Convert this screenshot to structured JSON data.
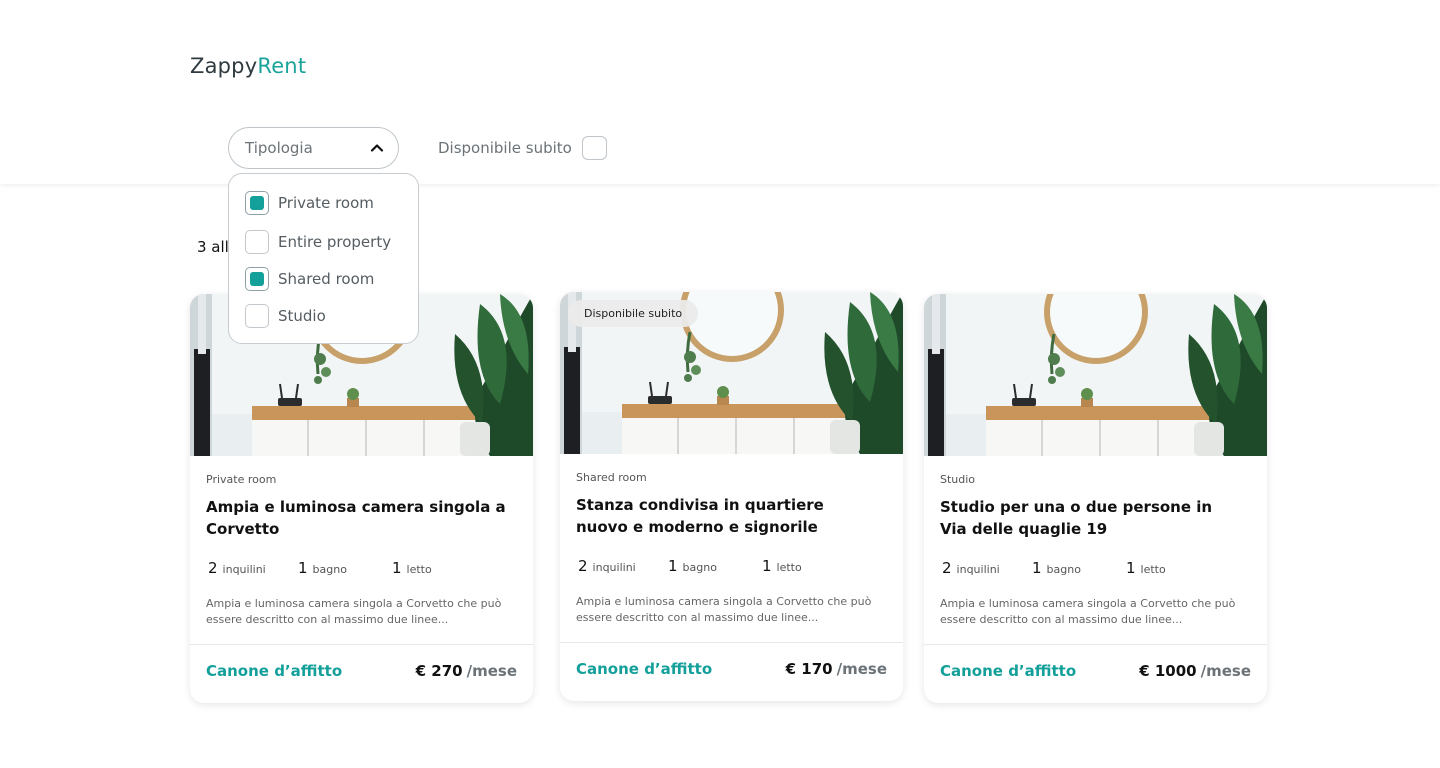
{
  "brand": {
    "name_main": "Zappy",
    "name_accent": "Rent",
    "accent_color": "#1aa39b"
  },
  "filters": {
    "type_select": {
      "placeholder": "Tipologia",
      "expanded": true
    },
    "available_now": {
      "label": "Disponibile subito",
      "checked": false
    },
    "type_options": [
      {
        "label": "Private room",
        "checked": true
      },
      {
        "label": "Entire property",
        "checked": false
      },
      {
        "label": "Shared room",
        "checked": true
      },
      {
        "label": "Studio",
        "checked": false
      }
    ]
  },
  "results": {
    "count_text": "3 all"
  },
  "listings": [
    {
      "badge": "",
      "type": "Private room",
      "title": "Ampia e luminosa camera singola a Corvetto",
      "tenants": "2",
      "tenants_unit": "inquilini",
      "bath": "1",
      "bath_unit": "bagno",
      "bed": "1",
      "bed_unit": "letto",
      "description": "Ampia e luminosa camera singola a Corvetto che può essere descritto con al massimo due linee...",
      "rent_label": "Canone d’affitto",
      "price": "€ 270",
      "per": "/mese"
    },
    {
      "badge": "Disponibile subito",
      "type": "Shared room",
      "title": "Stanza condivisa in quartiere nuovo e moderno e signorile",
      "tenants": "2",
      "tenants_unit": "inquilini",
      "bath": "1",
      "bath_unit": "bagno",
      "bed": "1",
      "bed_unit": "letto",
      "description": "Ampia e luminosa camera singola a Corvetto che può essere descritto con al massimo due linee...",
      "rent_label": "Canone d’affitto",
      "price": "€ 170",
      "per": "/mese"
    },
    {
      "badge": "",
      "type": "Studio",
      "title": "Studio per una o due persone in Via delle quaglie 19",
      "tenants": "2",
      "tenants_unit": "inquilini",
      "bath": "1",
      "bath_unit": "bagno",
      "bed": "1",
      "bed_unit": "letto",
      "description": "Ampia e luminosa camera singola a Corvetto che può essere descritto con al massimo due linee...",
      "rent_label": "Canone d’affitto",
      "price": "€ 1000",
      "per": "/mese"
    }
  ]
}
